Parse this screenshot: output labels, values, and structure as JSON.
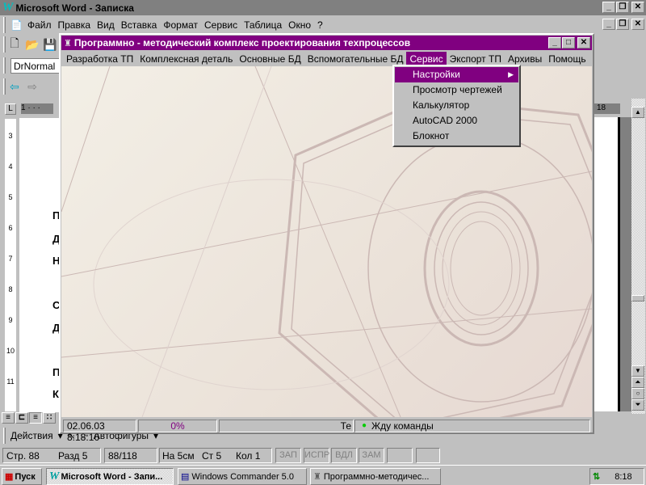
{
  "word": {
    "title": "Microsoft Word - Записка",
    "menu": [
      "Файл",
      "Правка",
      "Вид",
      "Вставка",
      "Формат",
      "Сервис",
      "Таблица",
      "Окно",
      "?"
    ],
    "style_box": "DrNormal",
    "ruler_right": "18",
    "doc_letters": [
      "П",
      "Д",
      "Н",
      "С",
      "Д",
      "П",
      "К"
    ],
    "ruler_numbers": [
      "3",
      "4",
      "5",
      "6",
      "7",
      "8",
      "9",
      "10",
      "11"
    ],
    "drawing": {
      "actions": "Действия",
      "autoshapes": "Автофигуры"
    },
    "status": {
      "page": "Стр. 88",
      "section": "Разд 5",
      "pages": "88/118",
      "at": "На 5см",
      "line": "Ст 5",
      "col": "Кол 1",
      "rec": "ЗАП",
      "trk": "ИСПР",
      "ext": "ВДЛ",
      "ovr": "ЗАМ"
    }
  },
  "app": {
    "title": "Программно - методический комплекс проектирования техпроцессов",
    "menu": [
      "Разработка ТП",
      "Комплексная деталь",
      "Основные БД",
      "Вспомогательные БД",
      "Сервис",
      "Экспорт ТП",
      "Архивы",
      "Помощь"
    ],
    "active_menu": "Сервис",
    "dropdown": [
      "Настройки",
      "Просмотр чертежей",
      "Калькулятор",
      "AutoCAD 2000",
      "Блокнот"
    ],
    "status": {
      "datetime": "02.06.03 8:18:16",
      "progress": "0%",
      "progress_value": 0,
      "truncated": "Те",
      "message": "Жду команды"
    },
    "colors": {
      "title": "#800080",
      "highlight": "#800080"
    }
  },
  "taskbar": {
    "start": "Пуск",
    "tasks": [
      "Microsoft Word - Запи...",
      "Windows Commander 5.0",
      "Программно-методичес..."
    ],
    "clock": "8:18"
  }
}
